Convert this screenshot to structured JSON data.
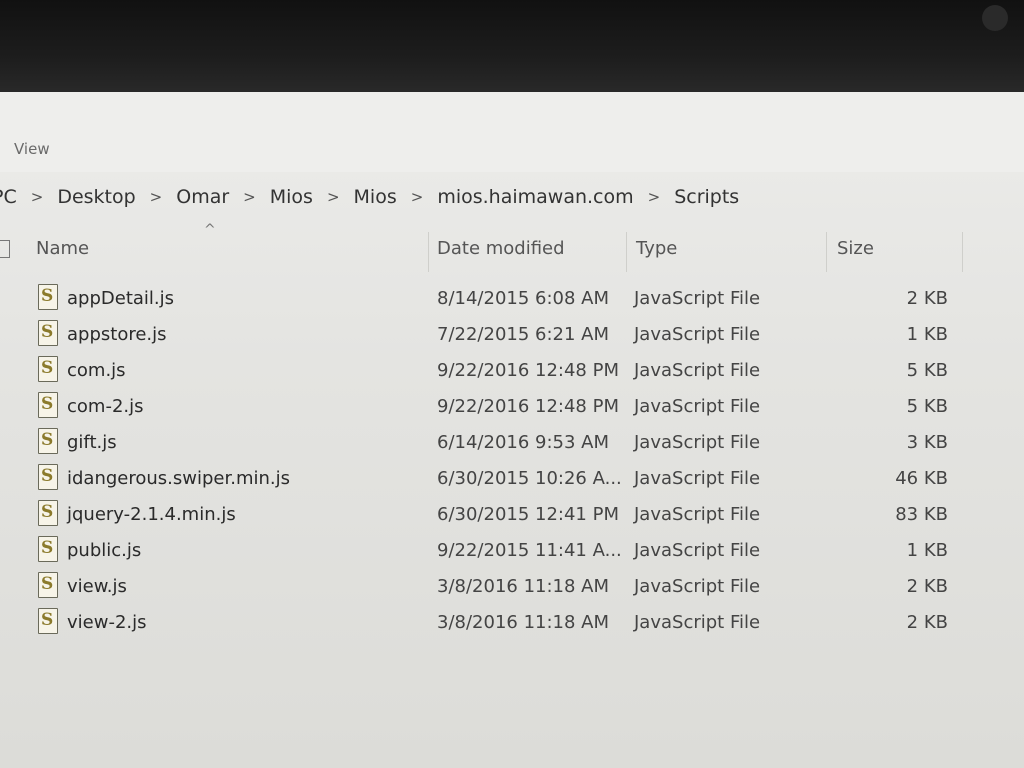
{
  "ribbon": {
    "view_tab": "View"
  },
  "breadcrumb": {
    "items": [
      "PC",
      "Desktop",
      "Omar",
      "Mios",
      "Mios",
      "mios.haimawan.com",
      "Scripts"
    ]
  },
  "columns": {
    "name": "Name",
    "date": "Date modified",
    "type": "Type",
    "size": "Size"
  },
  "files": [
    {
      "name": "appDetail.js",
      "date": "8/14/2015 6:08 AM",
      "type": "JavaScript File",
      "size": "2 KB"
    },
    {
      "name": "appstore.js",
      "date": "7/22/2015 6:21 AM",
      "type": "JavaScript File",
      "size": "1 KB"
    },
    {
      "name": "com.js",
      "date": "9/22/2016 12:48 PM",
      "type": "JavaScript File",
      "size": "5 KB"
    },
    {
      "name": "com-2.js",
      "date": "9/22/2016 12:48 PM",
      "type": "JavaScript File",
      "size": "5 KB"
    },
    {
      "name": "gift.js",
      "date": "6/14/2016 9:53 AM",
      "type": "JavaScript File",
      "size": "3 KB"
    },
    {
      "name": "idangerous.swiper.min.js",
      "date": "6/30/2015 10:26 A...",
      "type": "JavaScript File",
      "size": "46 KB"
    },
    {
      "name": "jquery-2.1.4.min.js",
      "date": "6/30/2015 12:41 PM",
      "type": "JavaScript File",
      "size": "83 KB"
    },
    {
      "name": "public.js",
      "date": "9/22/2015 11:41 A...",
      "type": "JavaScript File",
      "size": "1 KB"
    },
    {
      "name": "view.js",
      "date": "3/8/2016 11:18 AM",
      "type": "JavaScript File",
      "size": "2 KB"
    },
    {
      "name": "view-2.js",
      "date": "3/8/2016 11:18 AM",
      "type": "JavaScript File",
      "size": "2 KB"
    }
  ],
  "icons": {
    "file_icon": "javascript-file-icon",
    "sort_icon": "sort-ascending-icon",
    "separator_icon": "chevron-right-icon"
  }
}
